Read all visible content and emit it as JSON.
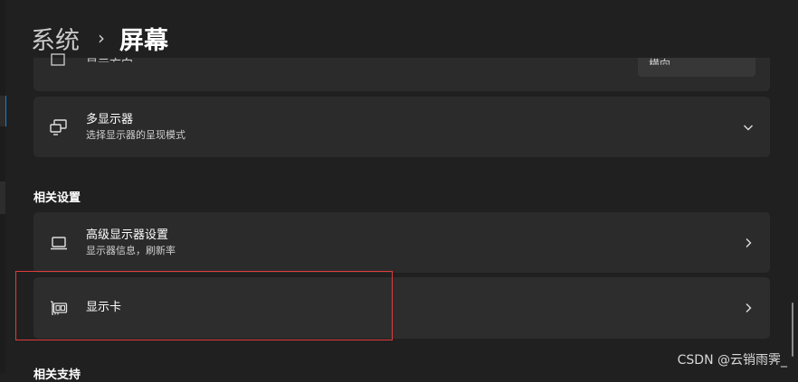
{
  "breadcrumb": {
    "parent": "系统",
    "separator": "›",
    "current": "屏幕"
  },
  "top_card": {
    "partial_title": "显示方向",
    "dropdown_value": "横向"
  },
  "multi_display": {
    "title": "多显示器",
    "subtitle": "选择显示器的呈现模式"
  },
  "related_settings": {
    "label": "相关设置",
    "advanced_display": {
      "title": "高级显示器设置",
      "subtitle": "显示器信息，刷新率"
    },
    "graphics": {
      "title": "显示卡"
    }
  },
  "bottom_section": {
    "label": "相关支持"
  },
  "watermark": "CSDN @云销雨霁_",
  "colors": {
    "background": "#202020",
    "card": "#2b2b2b",
    "highlight": "#e03c3c",
    "accent": "#0a84d8"
  }
}
